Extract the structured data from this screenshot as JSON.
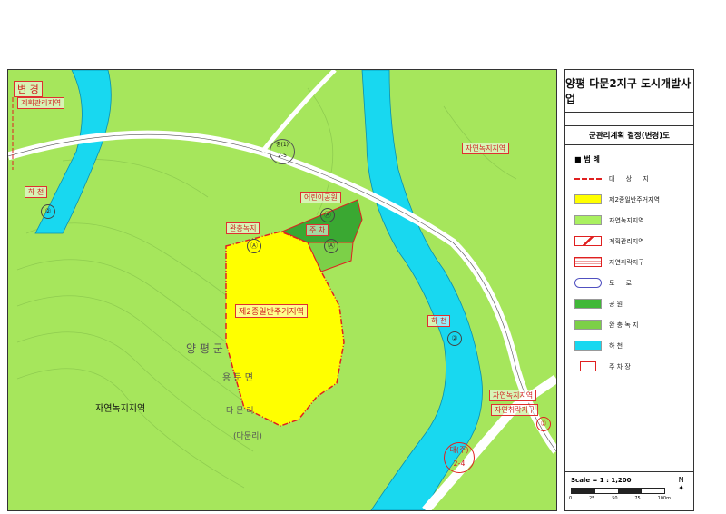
{
  "map": {
    "change_mark": "변 경",
    "labels": {
      "plan_mgmt": "계획관리지역",
      "natural_green_ne": "자연녹지지역",
      "river_w": "하      천",
      "river_e": "하      천",
      "playground_park": "어린이공원",
      "buffer_green": "완충녹지",
      "parking": "주 차",
      "residential2": "제2종일반주거지역",
      "county": "양     평     군",
      "town": "용     문     면",
      "village": "다   문   리",
      "village_paren": "(다문리)",
      "natural_green_sw": "자연녹지지역",
      "natural_green_se": "자연녹지지역",
      "natural_district": "자연취락지구",
      "road_label_1": "중(1)",
      "road_label_1b": "2-5",
      "road_label_2": "대(주)",
      "road_label_2b": "2-4",
      "circle_2_w": "②",
      "circle_2_e": "②",
      "circle_1": "①",
      "circle_a1": "Ⓐ",
      "circle_a2": "Ⓐ",
      "circle_a3": "Ⓐ"
    }
  },
  "legend": {
    "project_title": "양평 다문2지구 도시개발사업",
    "subtitle": "군관리계획 결정(변경)도",
    "heading": "■ 범 례",
    "items": [
      {
        "label": "대 상 지",
        "swatch": "boundary"
      },
      {
        "label": "제2종일반주거지역",
        "swatch": "#ffff00"
      },
      {
        "label": "자연녹지지역",
        "swatch": "#aaf060"
      },
      {
        "label": "계획관리지역",
        "swatch": "hatch"
      },
      {
        "label": "자연취락지구",
        "swatch": "village"
      },
      {
        "label": "도      로",
        "swatch": "road"
      },
      {
        "label": "공      원",
        "swatch": "#40b838"
      },
      {
        "label": "완 충 녹 지",
        "swatch": "#7cd048"
      },
      {
        "label": "하      천",
        "swatch": "#18d8f0"
      },
      {
        "label": "주 차 장",
        "swatch": "parking"
      }
    ],
    "scale": "Scale = 1 : 1,200",
    "scale_ticks": [
      "0",
      "25",
      "50",
      "75",
      "100m"
    ],
    "north": "N"
  },
  "colors": {
    "green": "#a6e65c",
    "river": "#18d8f0",
    "residential": "#ffff00",
    "park": "#3aa832",
    "buffer": "#7cd048",
    "boundary": "#e02020"
  }
}
